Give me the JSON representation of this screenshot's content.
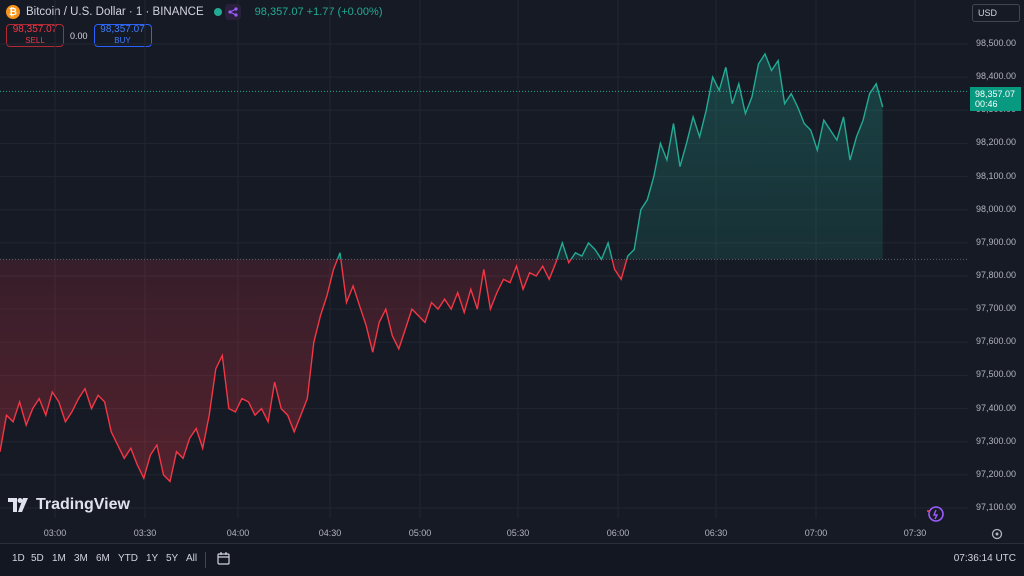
{
  "header": {
    "symbol": "Bitcoin / U.S. Dollar · 1 · BINANCE",
    "last_price": "98,357.07",
    "change": "+1.77 (+0.00%)"
  },
  "trade": {
    "sell_price": "98,357.07",
    "sell_label": "SELL",
    "spread": "0.00",
    "buy_price": "98,357.07",
    "buy_label": "BUY"
  },
  "currency": "USD",
  "price_axis": [
    "98,500.00",
    "98,400.00",
    "98,300.00",
    "98,200.00",
    "98,100.00",
    "98,000.00",
    "97,900.00",
    "97,800.00",
    "97,700.00",
    "97,600.00",
    "97,500.00",
    "97,400.00",
    "97,300.00",
    "97,200.00",
    "97,100.00"
  ],
  "current_tag": {
    "price": "98,357.07",
    "countdown": "00:46"
  },
  "time_axis": [
    "03:00",
    "03:30",
    "04:00",
    "04:30",
    "05:00",
    "05:30",
    "06:00",
    "06:30",
    "07:00",
    "07:30"
  ],
  "logo_text": "TradingView",
  "ranges": [
    "1D",
    "5D",
    "1M",
    "3M",
    "6M",
    "YTD",
    "1Y",
    "5Y",
    "All"
  ],
  "clock": "07:36:14 UTC",
  "colors": {
    "up": "#22ab94",
    "down": "#f23645",
    "bg": "#161a25"
  },
  "chart_data": {
    "type": "line",
    "baseline": 97850,
    "ylim": [
      97050,
      98560
    ],
    "x_range": [
      "02:50",
      "07:36"
    ],
    "x_minutes": [
      0,
      2,
      4,
      6,
      8,
      10,
      12,
      14,
      16,
      18,
      20,
      22,
      24,
      26,
      28,
      30,
      32,
      34,
      36,
      38,
      40,
      42,
      44,
      46,
      48,
      50,
      52,
      54,
      56,
      58,
      60,
      62,
      64,
      66,
      68,
      70,
      72,
      74,
      76,
      78,
      80,
      82,
      84,
      86,
      88,
      90,
      92,
      94,
      96,
      98,
      100,
      102,
      104,
      106,
      108,
      110,
      112,
      114,
      116,
      118,
      120,
      122,
      124,
      126,
      128,
      130,
      132,
      134,
      136,
      138,
      140,
      142,
      144,
      146,
      148,
      150,
      152,
      154,
      156,
      158,
      160,
      162,
      164,
      166,
      168,
      170,
      172,
      174,
      176,
      178,
      180,
      182,
      184,
      186,
      188,
      190,
      192,
      194,
      196,
      198,
      200,
      202,
      204,
      206,
      208,
      210,
      212,
      214,
      216,
      218,
      220,
      222,
      224,
      226,
      228,
      230,
      232,
      234,
      236,
      238,
      240,
      242,
      244,
      246,
      248,
      250,
      252,
      254,
      256,
      258,
      260,
      262,
      264,
      266,
      268,
      270,
      272,
      274,
      276,
      278,
      280,
      282,
      284,
      286
    ],
    "values": [
      97270,
      97380,
      97360,
      97420,
      97350,
      97400,
      97430,
      97380,
      97450,
      97420,
      97360,
      97390,
      97430,
      97460,
      97400,
      97440,
      97420,
      97330,
      97290,
      97250,
      97280,
      97230,
      97190,
      97260,
      97290,
      97200,
      97180,
      97270,
      97250,
      97310,
      97340,
      97280,
      97380,
      97520,
      97560,
      97400,
      97390,
      97430,
      97420,
      97380,
      97400,
      97360,
      97480,
      97400,
      97380,
      97330,
      97380,
      97430,
      97600,
      97680,
      97740,
      97820,
      97870,
      97720,
      97770,
      97710,
      97650,
      97570,
      97660,
      97700,
      97620,
      97580,
      97640,
      97700,
      97680,
      97660,
      97720,
      97700,
      97730,
      97700,
      97750,
      97690,
      97760,
      97700,
      97820,
      97700,
      97750,
      97790,
      97780,
      97830,
      97760,
      97810,
      97800,
      97830,
      97790,
      97840,
      97900,
      97840,
      97870,
      97860,
      97900,
      97880,
      97850,
      97900,
      97820,
      97790,
      97860,
      97880,
      98000,
      98030,
      98100,
      98200,
      98150,
      98260,
      98130,
      98200,
      98280,
      98220,
      98300,
      98400,
      98360,
      98430,
      98320,
      98380,
      98290,
      98340,
      98440,
      98470,
      98420,
      98450,
      98320,
      98350,
      98310,
      98260,
      98240,
      98180,
      98270,
      98240,
      98210,
      98280,
      98150,
      98220,
      98270,
      98350,
      98380,
      98310
    ],
    "series": [
      {
        "values_note_ref": "values"
      }
    ],
    "price_line": 98357.07
  }
}
